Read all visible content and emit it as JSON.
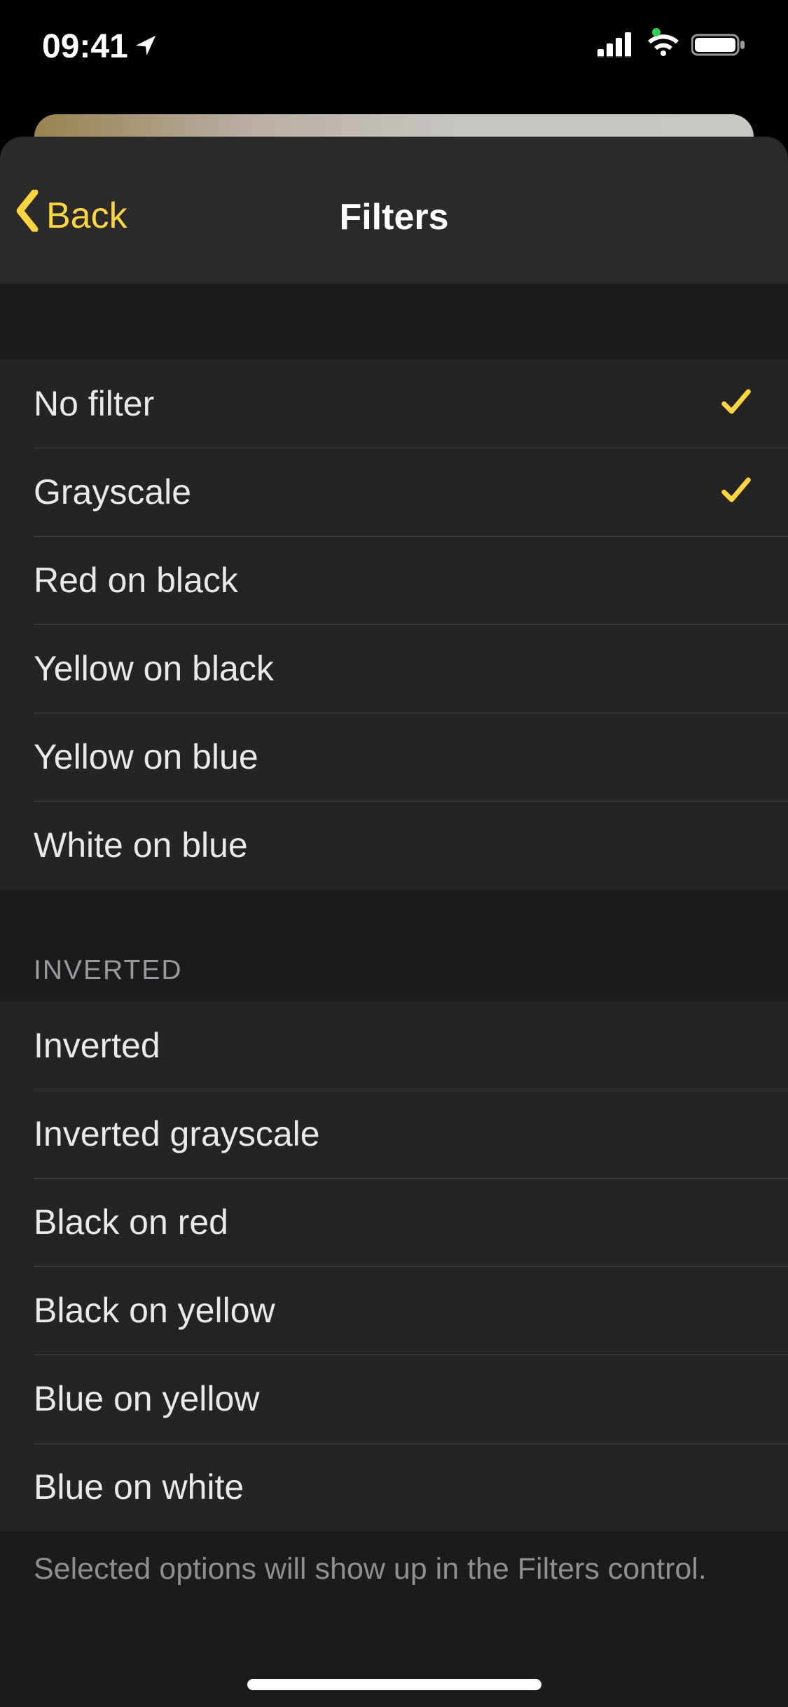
{
  "status_bar": {
    "time": "09:41",
    "location_icon": "location-arrow-icon",
    "signal": "signal-icon",
    "wifi": "wifi-icon",
    "battery": "battery-icon"
  },
  "nav": {
    "back_label": "Back",
    "title": "Filters"
  },
  "accent_color": "#ffd53e",
  "sections": [
    {
      "header": "",
      "items": [
        {
          "label": "No filter",
          "checked": true
        },
        {
          "label": "Grayscale",
          "checked": true
        },
        {
          "label": "Red on black",
          "checked": false
        },
        {
          "label": "Yellow on black",
          "checked": false
        },
        {
          "label": "Yellow on blue",
          "checked": false
        },
        {
          "label": "White on blue",
          "checked": false
        }
      ]
    },
    {
      "header": "INVERTED",
      "items": [
        {
          "label": "Inverted",
          "checked": false
        },
        {
          "label": "Inverted grayscale",
          "checked": false
        },
        {
          "label": "Black on red",
          "checked": false
        },
        {
          "label": "Black on yellow",
          "checked": false
        },
        {
          "label": "Blue on yellow",
          "checked": false
        },
        {
          "label": "Blue on white",
          "checked": false
        }
      ]
    }
  ],
  "footer": "Selected options will show up in the Filters control."
}
